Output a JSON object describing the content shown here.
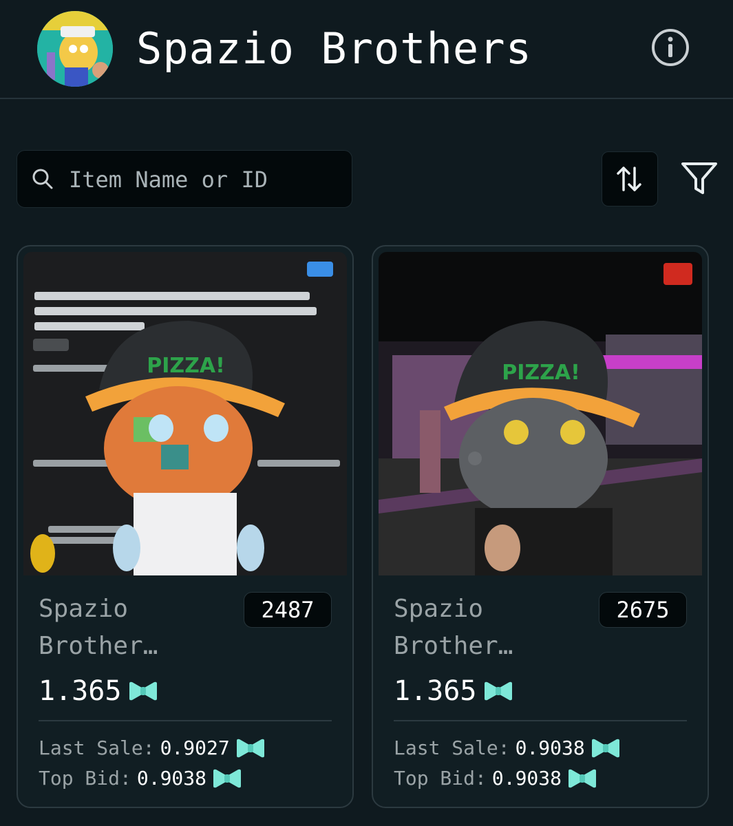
{
  "header": {
    "title": "Spazio Brothers",
    "avatar_icon": "collection-avatar",
    "info_icon": "info-icon"
  },
  "search": {
    "placeholder": "Item Name or ID",
    "value": ""
  },
  "toolbar": {
    "sort_icon": "sort-arrows-icon",
    "filter_icon": "filter-funnel-icon"
  },
  "currency_icon": "bow-tie-currency-icon",
  "colors": {
    "background": "#0f1a1f",
    "accent": "#7ee8d8",
    "text_muted": "#9aa3a6"
  },
  "items": [
    {
      "name": "Spazio Brother…",
      "id": "2487",
      "price": "1.365",
      "last_sale_label": "Last Sale:",
      "last_sale": "0.9027",
      "top_bid_label": "Top Bid:",
      "top_bid": "0.9038"
    },
    {
      "name": "Spazio Brother…",
      "id": "2675",
      "price": "1.365",
      "last_sale_label": "Last Sale:",
      "last_sale": "0.9038",
      "top_bid_label": "Top Bid:",
      "top_bid": "0.9038"
    }
  ]
}
